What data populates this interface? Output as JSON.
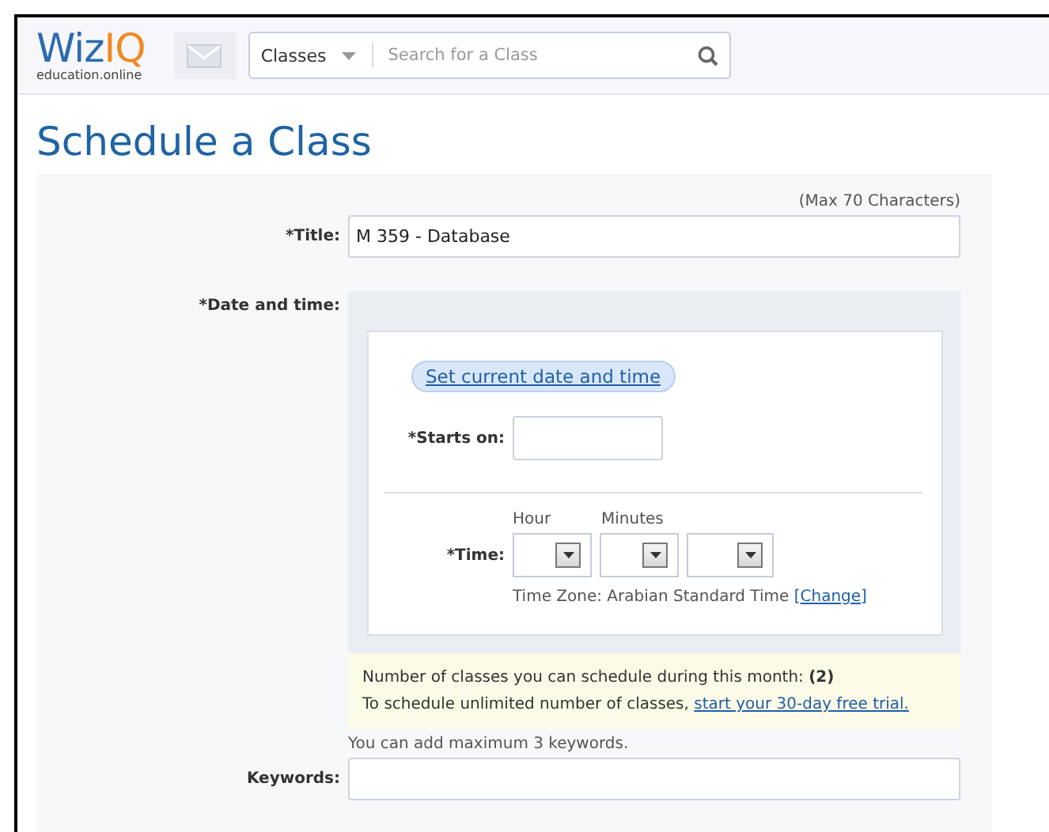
{
  "header": {
    "logo": {
      "primary": "Wiz",
      "accent": "IQ",
      "tagline": "education.online"
    },
    "search": {
      "category": "Classes",
      "placeholder": "Search for a Class"
    }
  },
  "page_title": "Schedule a Class",
  "form": {
    "title_hint": "(Max 70 Characters)",
    "title_label": "*Title:",
    "title_value": "M 359 - Database",
    "date_label": "*Date and time:",
    "set_current_button": "Set current date and time",
    "starts_label": "*Starts on:",
    "time_label": "*Time:",
    "selects": [
      {
        "kind": "hour",
        "caption": "Hour"
      },
      {
        "kind": "minute",
        "caption": "Minutes"
      },
      {
        "kind": "period"
      }
    ],
    "time_zone": "Time Zone: Arabian Standard Time",
    "bracket_open": "[",
    "change_link": "Change",
    "bracket_close": "]",
    "quota_text": "Number of classes you can schedule during this month: **(2)**",
    "trial_text": "To schedule unlimited number of classes,",
    "trial_link": "start your 30-day free trial.",
    "keywords_hint": "You can add maximum 3 keywords.",
    "keywords_label": "Keywords:"
  }
}
